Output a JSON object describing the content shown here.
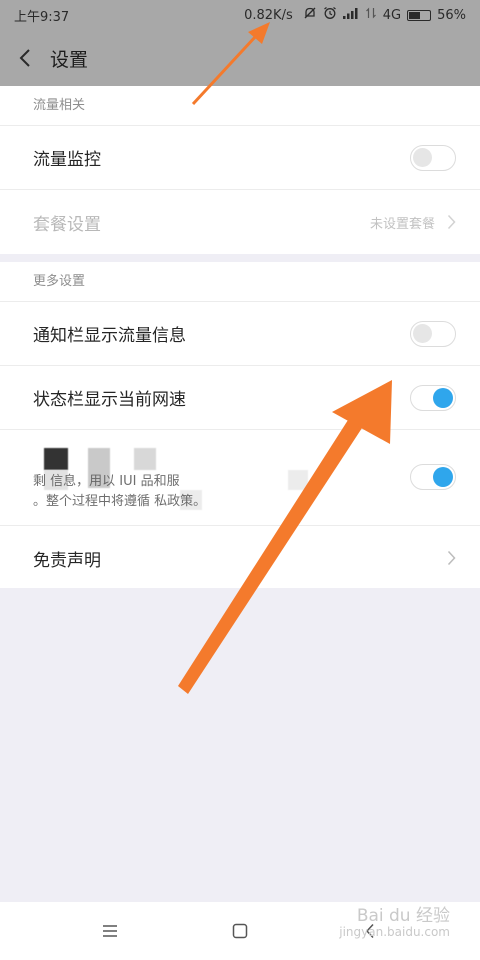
{
  "status_bar": {
    "time": "上午9:37",
    "net_speed": "0.82K/s",
    "network": "4G",
    "battery": "56%",
    "battery_level": 0.56
  },
  "header": {
    "title": "设置"
  },
  "sections": {
    "traffic": {
      "title": "流量相关",
      "monitor_label": "流量监控",
      "monitor_on": false,
      "plan_label": "套餐设置",
      "plan_value": "未设置套餐"
    },
    "more": {
      "title": "更多设置",
      "notify_label": "通知栏显示流量信息",
      "notify_on": false,
      "statusbar_label": "状态栏显示当前网速",
      "statusbar_on": true,
      "privacy_line1": "剩         信息，用以         IUI      品和服",
      "privacy_line2": "。整个过程中将遵循        私政策。",
      "privacy_on": true,
      "disclaimer_label": "免责声明"
    }
  },
  "watermark": {
    "brand": "Bai du 经验",
    "url": "jingyan.baidu.com"
  },
  "colors": {
    "accent": "#2fa6ec",
    "arrow": "#f47a2c",
    "background": "#efeef5"
  }
}
